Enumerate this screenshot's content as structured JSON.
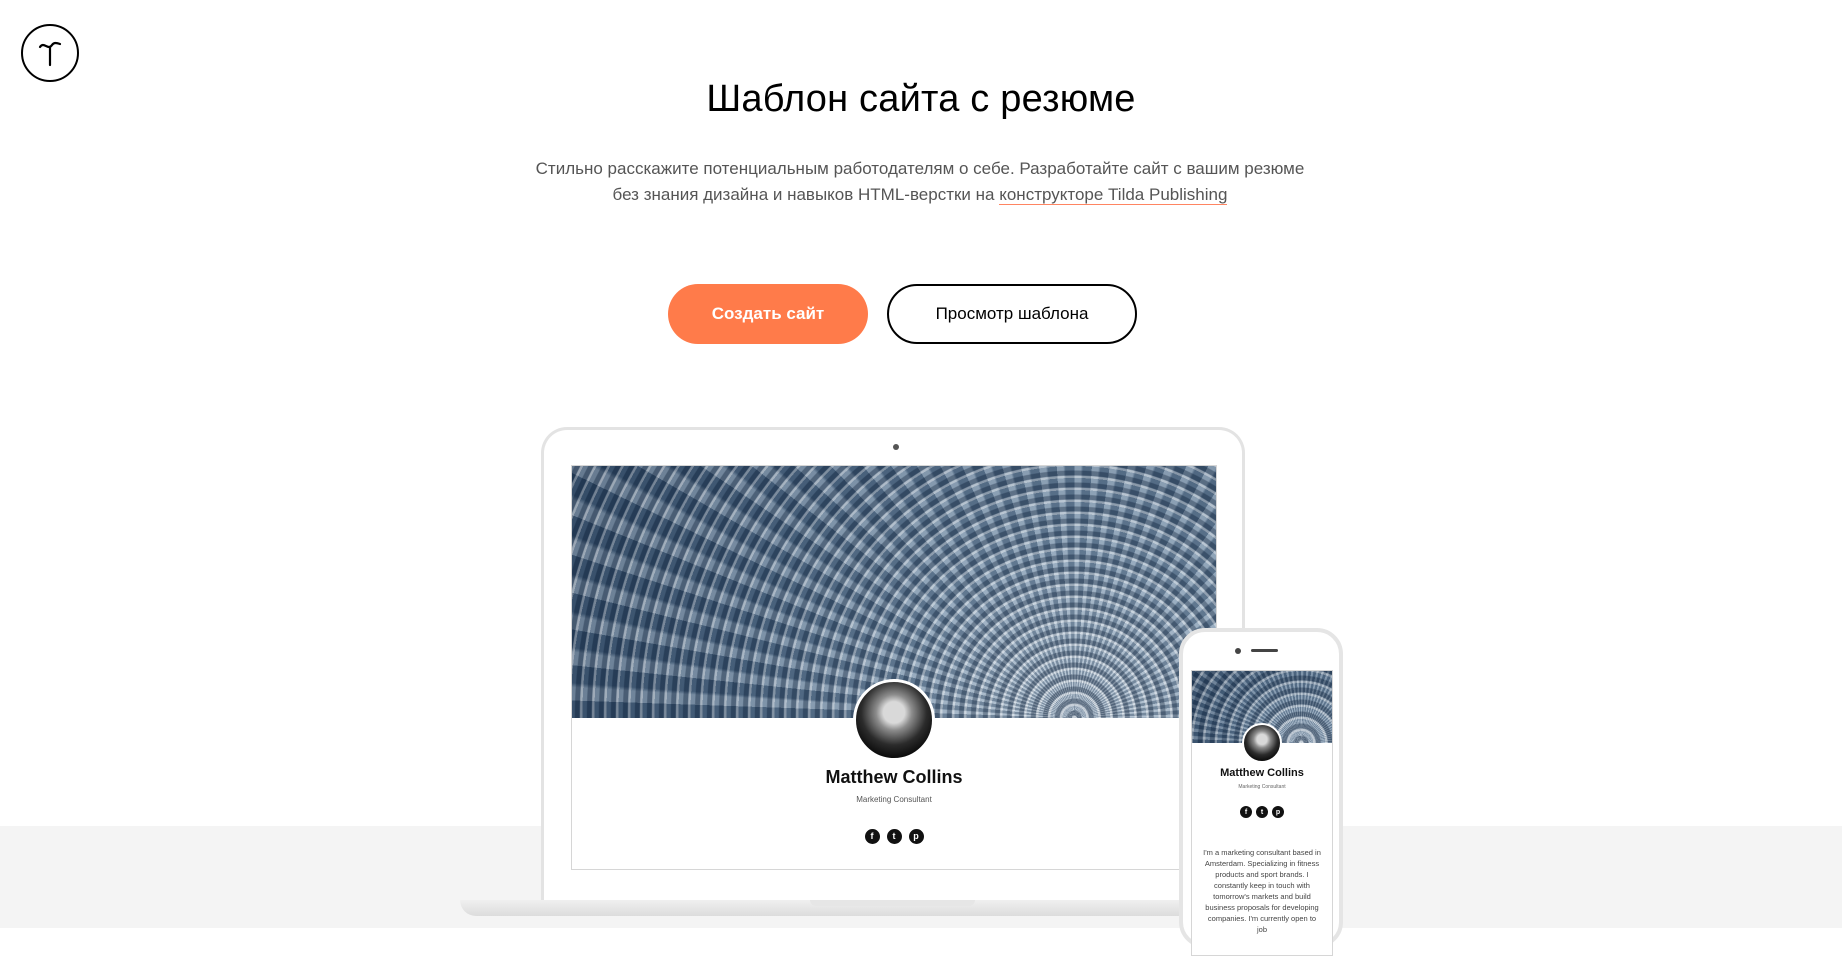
{
  "logo": {
    "icon": "tilda-logo-icon"
  },
  "hero": {
    "title": "Шаблон сайта с резюме",
    "subtitle_line1": "Стильно расскажите потенциальным работодателям о себе. Разработайте сайт с вашим резюме",
    "subtitle_line2_prefix": "без знания дизайна и навыков HTML-верстки на ",
    "subtitle_link": "конструкторе Tilda Publishing"
  },
  "buttons": {
    "create": "Создать сайт",
    "preview": "Просмотр шаблона"
  },
  "mockup": {
    "name": "Matthew Collins",
    "role": "Marketing Consultant",
    "socials": [
      {
        "icon": "facebook-icon",
        "glyph": "f"
      },
      {
        "icon": "twitter-icon",
        "glyph": "t"
      },
      {
        "icon": "pinterest-icon",
        "glyph": "p"
      }
    ],
    "bio": "I'm a marketing consultant based in Amsterdam. Specializing in fitness products and sport brands. I constantly keep in touch with tomorrow's markets and build business proposals for developing companies. I'm currently open to job"
  },
  "colors": {
    "accent": "#ff7b4a",
    "band": "#f4f4f4"
  }
}
